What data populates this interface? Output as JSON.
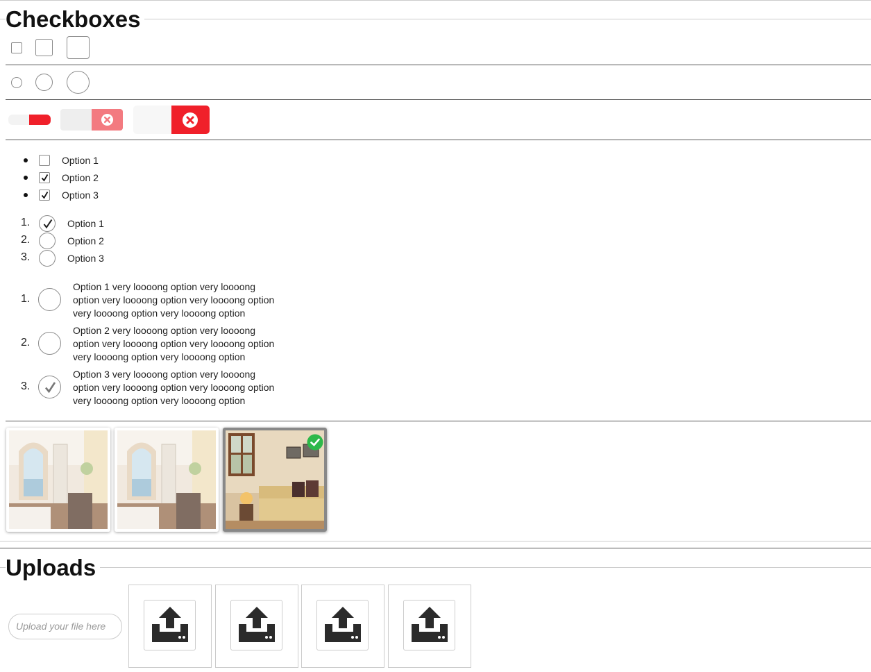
{
  "sections": {
    "checkboxes_title": "Checkboxes",
    "uploads_title": "Uploads"
  },
  "bullet_list": [
    {
      "label": "Option 1",
      "checked": false
    },
    {
      "label": "Option 2",
      "checked": true
    },
    {
      "label": "Option 3",
      "checked": true
    }
  ],
  "numbered_list": [
    {
      "num": "1.",
      "label": "Option 1",
      "checked": true
    },
    {
      "num": "2.",
      "label": "Option 2",
      "checked": false
    },
    {
      "num": "3.",
      "label": "Option 3",
      "checked": false
    }
  ],
  "long_list": [
    {
      "num": "1.",
      "lines": [
        "Option 1 very loooong option very loooong",
        "option very loooong option very loooong option",
        "very loooong option very loooong option"
      ],
      "checked": false
    },
    {
      "num": "2.",
      "lines": [
        "Option 2 very loooong option very loooong",
        "option very loooong option very loooong option",
        "very loooong option very loooong option"
      ],
      "checked": false
    },
    {
      "num": "3.",
      "lines": [
        "Option 3 very loooong option very loooong",
        "option very loooong option very loooong option",
        "very loooong option very loooong option"
      ],
      "checked": true
    }
  ],
  "image_picker": {
    "items": [
      {
        "name": "room-bright",
        "selected": false
      },
      {
        "name": "room-bright",
        "selected": false
      },
      {
        "name": "room-sofa",
        "selected": true
      }
    ]
  },
  "upload": {
    "placeholder": "Upload your file here",
    "buttons_count_label": [
      "upload-1",
      "upload-2",
      "upload-3",
      "upload-4"
    ]
  },
  "colors": {
    "toggle_red": "#f0202a",
    "toggle_light_red": "#f37a80",
    "selected_badge": "#2db84a"
  },
  "icons": {
    "toggle_off": "close-circle-icon",
    "check": "checkmark-icon",
    "upload": "upload-tray-icon",
    "selected": "check-badge-icon"
  }
}
